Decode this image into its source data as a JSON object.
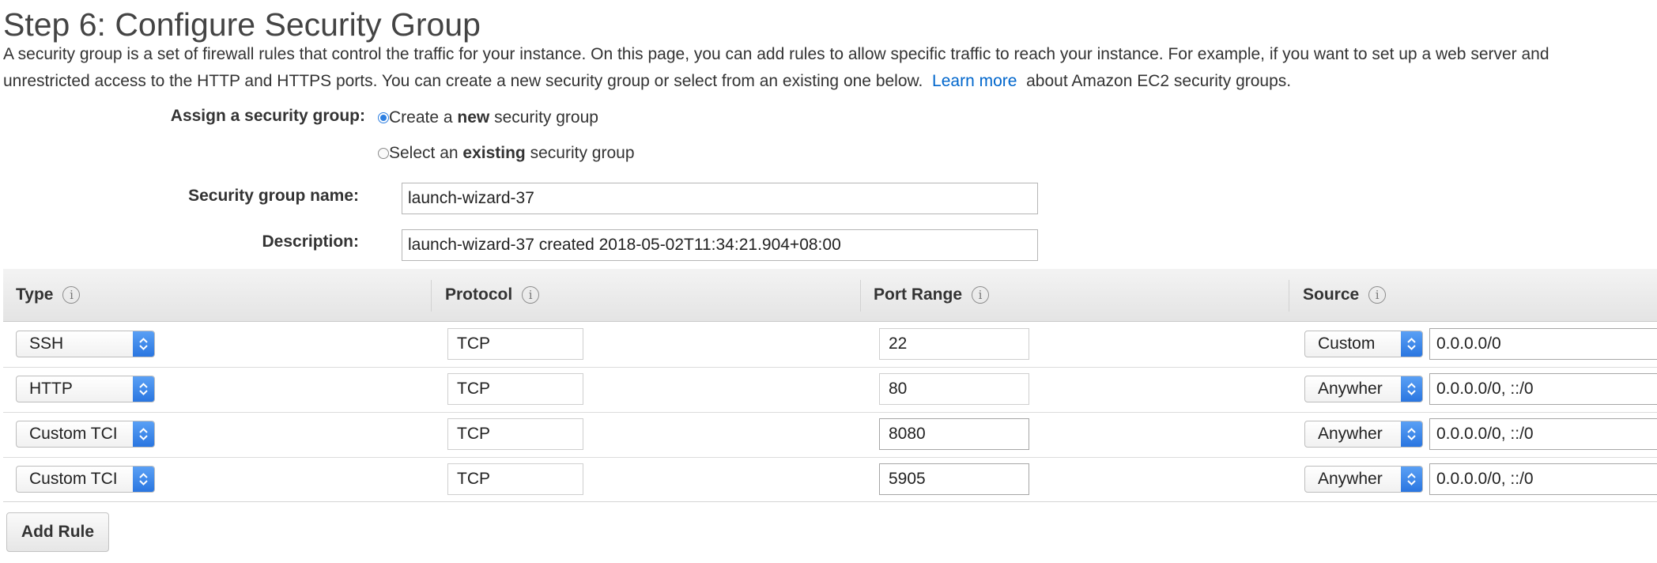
{
  "page": {
    "title": "Step 6: Configure Security Group",
    "intro_line1": "A security group is a set of firewall rules that control the traffic for your instance. On this page, you can add rules to allow specific traffic to reach your instance. For example, if you want to set up a web server and",
    "intro_line2_before": "unrestricted access to the HTTP and HTTPS ports. You can create a new security group or select from an existing one below.",
    "learn_more": "Learn more",
    "intro_line2_after": "about Amazon EC2 security groups."
  },
  "assign": {
    "label": "Assign a security group:",
    "create_option": {
      "prefix": "Create a ",
      "bold": "new",
      "suffix": " security group",
      "selected": true
    },
    "existing_option": {
      "prefix": "Select an ",
      "bold": "existing",
      "suffix": " security group",
      "selected": false
    }
  },
  "group_name": {
    "label": "Security group name:",
    "value": "launch-wizard-37"
  },
  "description": {
    "label": "Description:",
    "value": "launch-wizard-37 created 2018-05-02T11:34:21.904+08:00"
  },
  "table": {
    "headers": {
      "type": "Type",
      "protocol": "Protocol",
      "port_range": "Port Range",
      "source": "Source"
    },
    "info_glyph": "i",
    "rows": [
      {
        "type": "SSH",
        "protocol": "TCP",
        "port": "22",
        "source_mode": "Custom",
        "source_value": "0.0.0.0/0"
      },
      {
        "type": "HTTP",
        "protocol": "TCP",
        "port": "80",
        "source_mode": "Anywher",
        "source_value": "0.0.0.0/0, ::/0"
      },
      {
        "type": "Custom TCI",
        "protocol": "TCP",
        "port": "8080",
        "source_mode": "Anywher",
        "source_value": "0.0.0.0/0, ::/0"
      },
      {
        "type": "Custom TCI",
        "protocol": "TCP",
        "port": "5905",
        "source_mode": "Anywher",
        "source_value": "0.0.0.0/0, ::/0"
      }
    ]
  },
  "add_rule_label": "Add Rule",
  "colors": {
    "link": "#0066cc",
    "select_arrow": "#2a76e0",
    "radio_selected": "#2c7ee0"
  },
  "icons": {
    "info": "info-icon",
    "select_arrows": "chevron-up-down-icon"
  }
}
